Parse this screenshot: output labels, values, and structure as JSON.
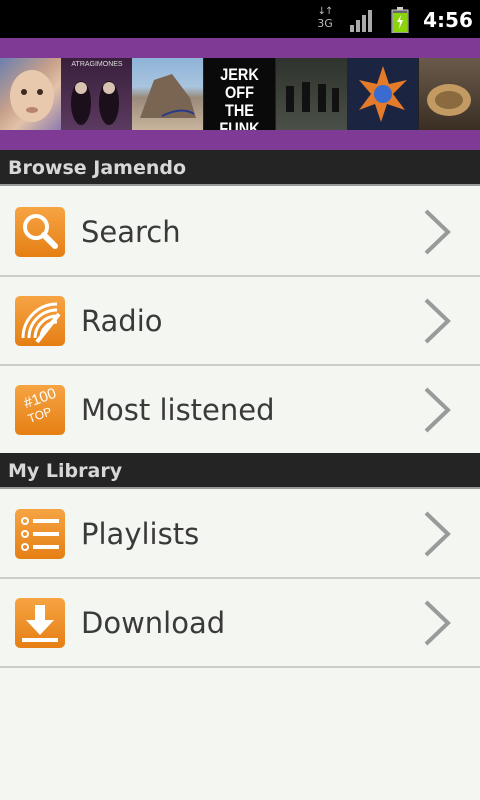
{
  "status_bar": {
    "network": "3G",
    "time": "4:56"
  },
  "banner": {
    "covers": [
      {
        "label": ""
      },
      {
        "label": "ATRAGIMONES"
      },
      {
        "label": ""
      },
      {
        "label": "JERK OFF THE FUNK"
      },
      {
        "label": ""
      },
      {
        "label": ""
      },
      {
        "label": ""
      }
    ]
  },
  "browse": {
    "header": "Browse Jamendo",
    "items": [
      {
        "label": "Search",
        "icon": "search-icon"
      },
      {
        "label": "Radio",
        "icon": "radio-icon"
      },
      {
        "label": "Most listened",
        "icon": "top100-icon",
        "badge_top": "#100",
        "badge_bottom": "TOP"
      }
    ]
  },
  "library": {
    "header": "My Library",
    "items": [
      {
        "label": "Playlists",
        "icon": "playlist-icon"
      },
      {
        "label": "Download",
        "icon": "download-icon"
      }
    ]
  },
  "colors": {
    "accent": "#7f3a95",
    "icon_orange": "#f08f22",
    "section_bg": "#242424",
    "list_bg": "#f4f6f2"
  }
}
